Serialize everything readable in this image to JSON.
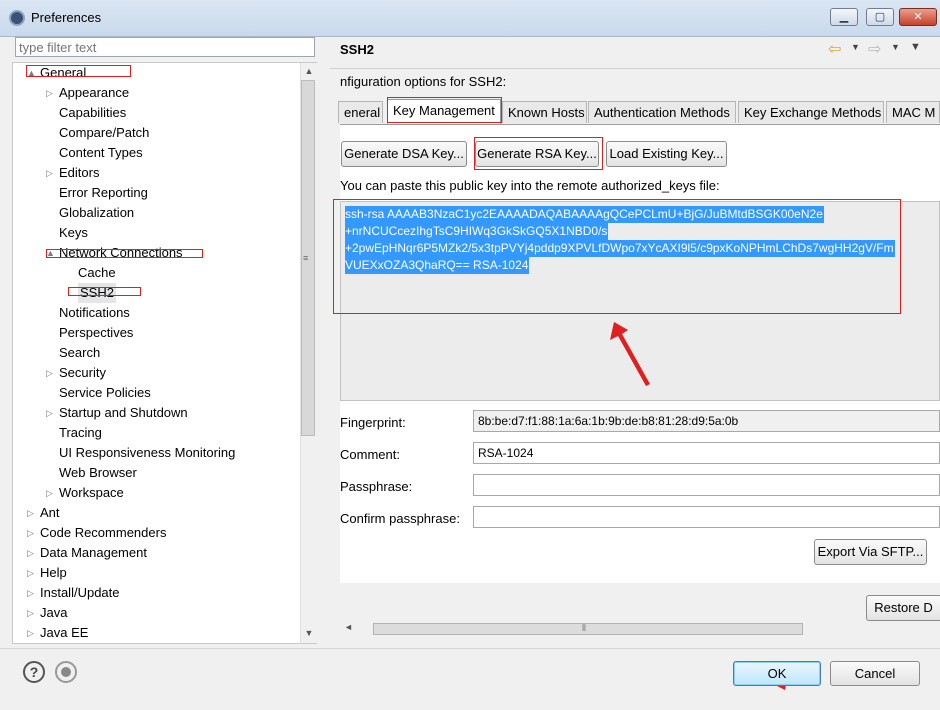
{
  "window": {
    "title": "Preferences",
    "minimize": "▁",
    "maximize": "▢",
    "close": "✕"
  },
  "filter": {
    "placeholder": "type filter text"
  },
  "tree": [
    {
      "label": "General",
      "twisty": "▲"
    },
    {
      "label": "Appearance",
      "twisty": "▷"
    },
    {
      "label": "Capabilities",
      "twisty": ""
    },
    {
      "label": "Compare/Patch",
      "twisty": ""
    },
    {
      "label": "Content Types",
      "twisty": ""
    },
    {
      "label": "Editors",
      "twisty": "▷"
    },
    {
      "label": "Error Reporting",
      "twisty": ""
    },
    {
      "label": "Globalization",
      "twisty": ""
    },
    {
      "label": "Keys",
      "twisty": ""
    },
    {
      "label": "Network Connections",
      "twisty": "▲"
    },
    {
      "label": "Cache",
      "twisty": ""
    },
    {
      "label": "SSH2",
      "twisty": ""
    },
    {
      "label": "Notifications",
      "twisty": ""
    },
    {
      "label": "Perspectives",
      "twisty": ""
    },
    {
      "label": "Search",
      "twisty": ""
    },
    {
      "label": "Security",
      "twisty": "▷"
    },
    {
      "label": "Service Policies",
      "twisty": ""
    },
    {
      "label": "Startup and Shutdown",
      "twisty": "▷"
    },
    {
      "label": "Tracing",
      "twisty": ""
    },
    {
      "label": "UI Responsiveness Monitoring",
      "twisty": ""
    },
    {
      "label": "Web Browser",
      "twisty": ""
    },
    {
      "label": "Workspace",
      "twisty": "▷"
    },
    {
      "label": "Ant",
      "twisty": "▷"
    },
    {
      "label": "Code Recommenders",
      "twisty": "▷"
    },
    {
      "label": "Data Management",
      "twisty": "▷"
    },
    {
      "label": "Help",
      "twisty": "▷"
    },
    {
      "label": "Install/Update",
      "twisty": "▷"
    },
    {
      "label": "Java",
      "twisty": "▷"
    },
    {
      "label": "Java EE",
      "twisty": "▷"
    }
  ],
  "page": {
    "title": "SSH2",
    "config_label": "nfiguration options for SSH2:",
    "tabs": [
      {
        "label": "eneral"
      },
      {
        "label": "Key Management"
      },
      {
        "label": "Known Hosts"
      },
      {
        "label": "Authentication Methods"
      },
      {
        "label": "Key Exchange Methods"
      },
      {
        "label": "MAC M"
      }
    ],
    "buttons": {
      "generate_dsa": "Generate DSA Key...",
      "generate_rsa": "Generate RSA Key...",
      "load_existing": "Load Existing Key...",
      "export": "Export Via SFTP...",
      "restore": "Restore D"
    },
    "paste_label": "You can paste this public key into the remote authorized_keys file:",
    "key_lines": [
      "ssh-rsa AAAAB3NzaC1yc2EAAAADAQABAAAAgQCePCLmU+BjG/JuBMtdBSGK00eN2e",
      "+nrNCUCcezIhgTsC9HIWq3GkSkGQ5X1NBD0/s",
      "+2pwEpHNqr6P5MZk2/5x3tpPVYj4pddp9XPVLfDWpo7xYcAXI9l5/c9pxKoNPHmLChDs7wgHH2gV/Fm",
      "VUEXxOZA3QhaRQ== RSA-1024"
    ],
    "fields": {
      "fingerprint_label": "Fingerprint:",
      "fingerprint_value": "8b:be:d7:f1:88:1a:6a:1b:9b:de:b8:81:28:d9:5a:0b",
      "comment_label": "Comment:",
      "comment_value": "RSA-1024",
      "passphrase_label": "Passphrase:",
      "passphrase_value": "",
      "confirm_label": "Confirm passphrase:",
      "confirm_value": ""
    }
  },
  "footer": {
    "ok": "OK",
    "cancel": "Cancel"
  },
  "colors": {
    "selection": "#3399ff",
    "annotation": "#e02020"
  }
}
